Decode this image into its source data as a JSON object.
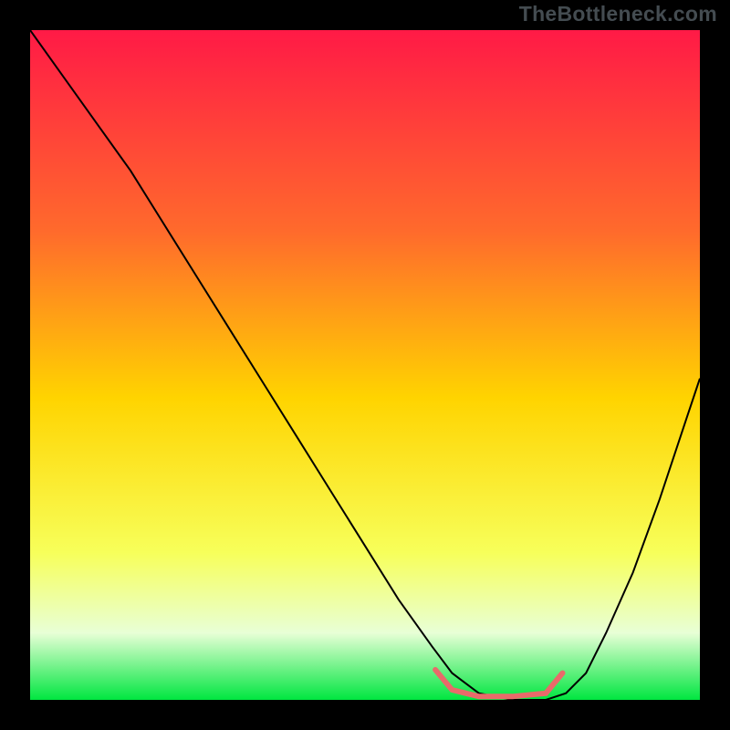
{
  "watermark": "TheBottleneck.com",
  "chart_data": {
    "type": "line",
    "title": "",
    "xlabel": "",
    "ylabel": "",
    "xlim": [
      0,
      100
    ],
    "ylim": [
      0,
      100
    ],
    "background": {
      "kind": "vertical-gradient",
      "stops": [
        {
          "pos": 0,
          "color": "#ff1a46"
        },
        {
          "pos": 30,
          "color": "#ff6a2c"
        },
        {
          "pos": 55,
          "color": "#ffd400"
        },
        {
          "pos": 78,
          "color": "#f7ff5a"
        },
        {
          "pos": 90,
          "color": "#e8ffd6"
        },
        {
          "pos": 100,
          "color": "#00e640"
        }
      ]
    },
    "series": [
      {
        "name": "bottleneck-curve",
        "color": "#000000",
        "stroke_width": 2,
        "x": [
          0,
          5,
          10,
          15,
          20,
          25,
          30,
          35,
          40,
          45,
          50,
          55,
          60,
          63,
          67,
          72,
          77,
          80,
          83,
          86,
          90,
          94,
          98,
          100
        ],
        "y": [
          100,
          93,
          86,
          79,
          71,
          63,
          55,
          47,
          39,
          31,
          23,
          15,
          8,
          4,
          1,
          0,
          0,
          1,
          4,
          10,
          19,
          30,
          42,
          48
        ]
      },
      {
        "name": "optimal-band-marker",
        "color": "#e96a6a",
        "stroke_width": 6,
        "x": [
          60.5,
          63,
          67,
          72,
          77,
          79.5
        ],
        "y": [
          4.5,
          1.5,
          0.5,
          0.5,
          1,
          4
        ]
      }
    ],
    "annotations": []
  }
}
